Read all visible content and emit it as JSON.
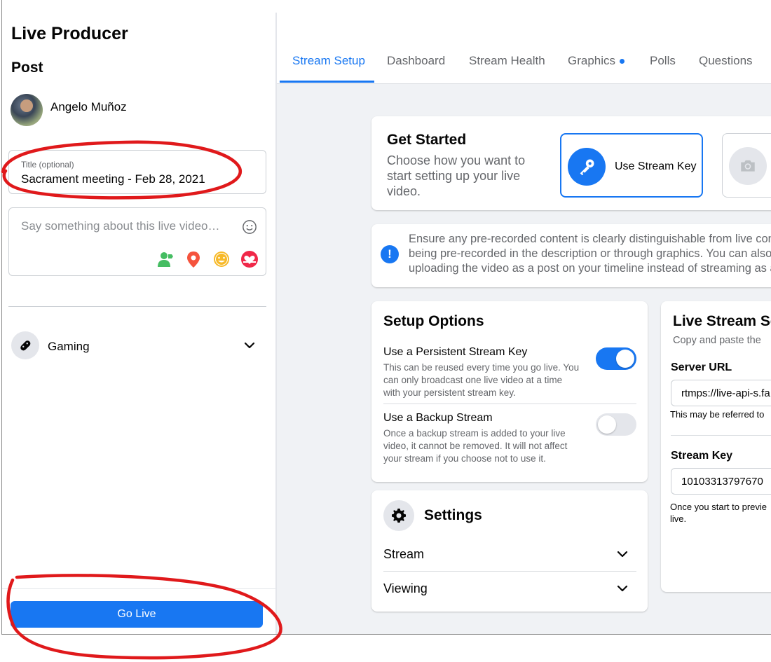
{
  "left_panel": {
    "app_title": "Live Producer",
    "section_title": "Post",
    "user_name": "Angelo Muñoz",
    "title_field": {
      "label": "Title (optional)",
      "value": "Sacrament meeting - Feb 28, 2021"
    },
    "description_field": {
      "placeholder": "Say something about this live video…"
    },
    "category": {
      "label": "Gaming"
    },
    "go_live_label": "Go Live"
  },
  "tabs": [
    {
      "label": "Stream Setup",
      "active": true
    },
    {
      "label": "Dashboard"
    },
    {
      "label": "Stream Health"
    },
    {
      "label": "Graphics"
    },
    {
      "label": "Polls"
    },
    {
      "label": "Questions"
    }
  ],
  "get_started": {
    "title": "Get Started",
    "subtitle": "Choose how you want to start setting up your live video.",
    "options": [
      {
        "label": "Use Stream Key",
        "icon": "key-icon",
        "selected": true
      },
      {
        "label": "",
        "icon": "camera-icon",
        "selected": false
      }
    ]
  },
  "notice": {
    "lines": [
      "Ensure any pre-recorded content is clearly distinguishable from live con",
      "being pre-recorded in the description or through graphics. You can also",
      "uploading the video as a post on your timeline instead of streaming as a"
    ]
  },
  "setup_options": {
    "title": "Setup Options",
    "persistent": {
      "title": "Use a Persistent Stream Key",
      "lines": [
        "This can be reused every time you go live. You",
        "can only broadcast one live video at a time",
        "with your persistent stream key."
      ],
      "enabled": true
    },
    "backup": {
      "title": "Use a Backup Stream",
      "lines": [
        "Once a backup stream is added to your live",
        "video, it cannot be removed. It will not affect",
        "your stream if you choose not to use it."
      ],
      "enabled": false
    }
  },
  "settings": {
    "title": "Settings",
    "rows": [
      {
        "label": "Stream"
      },
      {
        "label": "Viewing"
      }
    ]
  },
  "live_stream": {
    "title": "Live Stream Se",
    "subtitle": "Copy and paste the",
    "server_url": {
      "label": "Server URL",
      "value": "rtmps://live-api-s.fa",
      "note": "This may be referred to"
    },
    "stream_key": {
      "label": "Stream Key",
      "value": "10103313797670",
      "note_lines": [
        "Once you start to previe",
        "live."
      ]
    }
  },
  "colors": {
    "accent": "#1877f2",
    "annotation": "#e0191b",
    "background": "#f0f2f5"
  }
}
